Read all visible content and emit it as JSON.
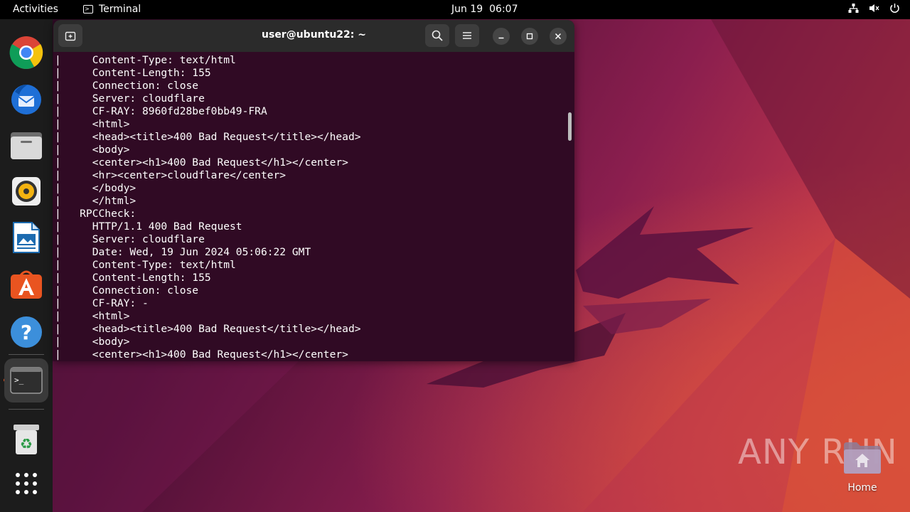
{
  "topbar": {
    "activities": "Activities",
    "app_name": "Terminal",
    "date": "Jun 19",
    "time": "06:07"
  },
  "dock": {
    "apps": [
      {
        "name": "Google Chrome",
        "icon": "chrome-icon"
      },
      {
        "name": "Thunderbird Mail",
        "icon": "thunderbird-icon"
      },
      {
        "name": "Files",
        "icon": "files-icon"
      },
      {
        "name": "Rhythmbox",
        "icon": "rhythmbox-icon"
      },
      {
        "name": "LibreOffice Writer",
        "icon": "writer-icon"
      },
      {
        "name": "Ubuntu Software",
        "icon": "software-icon"
      },
      {
        "name": "Help",
        "icon": "help-icon"
      },
      {
        "name": "Terminal",
        "icon": "terminal-icon"
      },
      {
        "name": "Trash",
        "icon": "trash-icon"
      },
      {
        "name": "Show Applications",
        "icon": "apps-grid-icon"
      }
    ],
    "accent": "#e95420"
  },
  "terminal": {
    "title": "user@ubuntu22: ~",
    "background": "#300a24",
    "lines": [
      "|     Content-Type: text/html",
      "|     Content-Length: 155",
      "|     Connection: close",
      "|     Server: cloudflare",
      "|     CF-RAY: 8960fd28bef0bb49-FRA",
      "|     <html>",
      "|     <head><title>400 Bad Request</title></head>",
      "|     <body>",
      "|     <center><h1>400 Bad Request</h1></center>",
      "|     <hr><center>cloudflare</center>",
      "|     </body>",
      "|     </html>",
      "|   RPCCheck:",
      "|     HTTP/1.1 400 Bad Request",
      "|     Server: cloudflare",
      "|     Date: Wed, 19 Jun 2024 05:06:22 GMT",
      "|     Content-Type: text/html",
      "|     Content-Length: 155",
      "|     Connection: close",
      "|     CF-RAY: -",
      "|     <html>",
      "|     <head><title>400 Bad Request</title></head>",
      "|     <body>",
      "|     <center><h1>400 Bad Request</h1></center>"
    ]
  },
  "desktop": {
    "home_label": "Home",
    "watermark": "ANY RUN"
  }
}
